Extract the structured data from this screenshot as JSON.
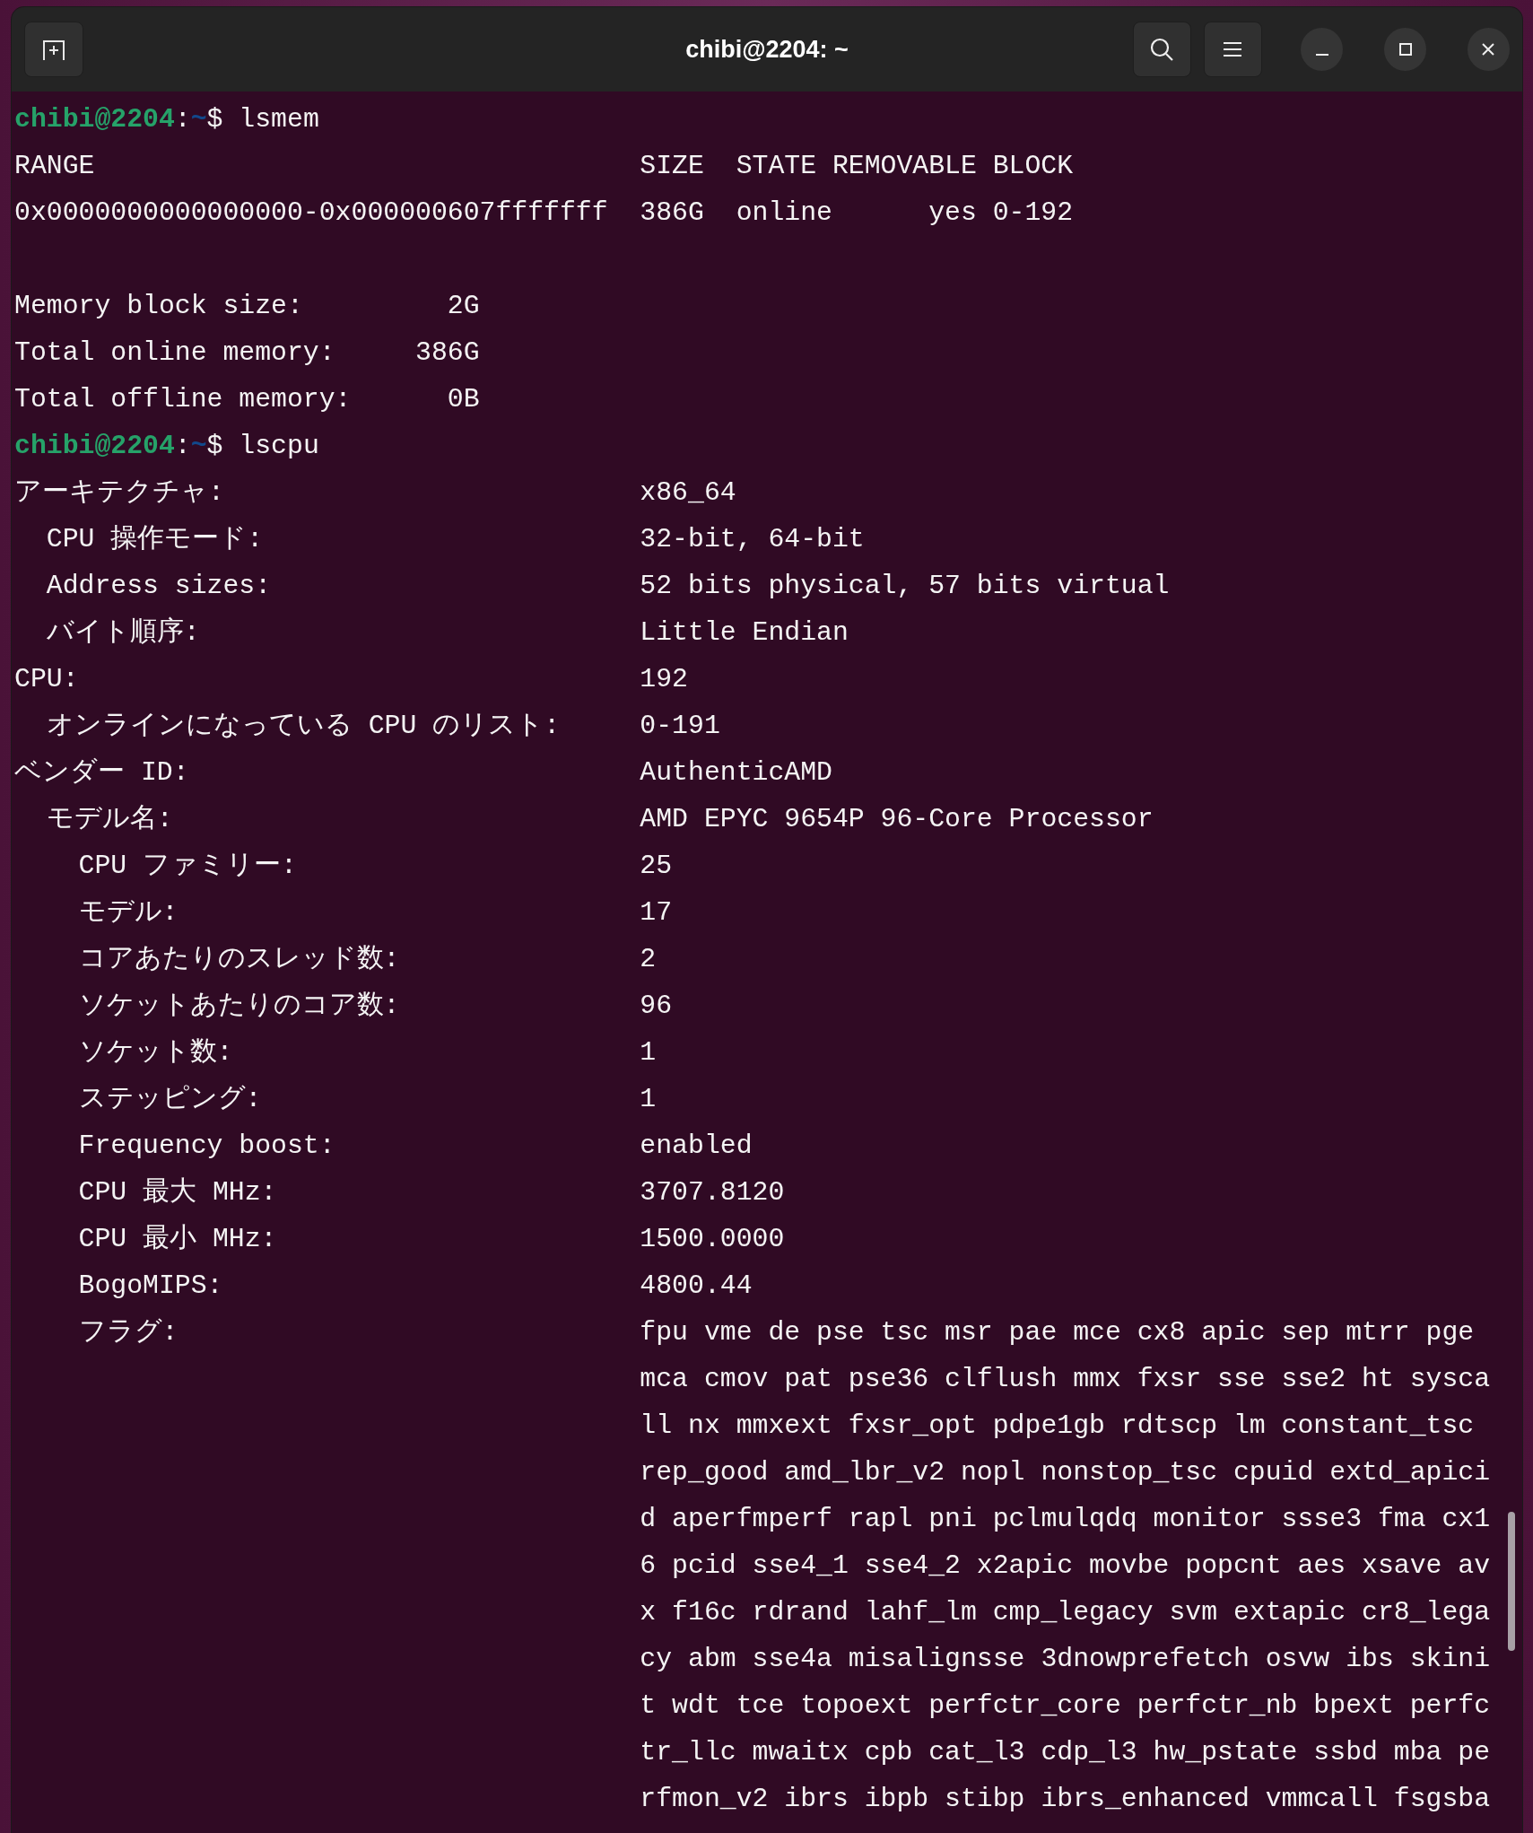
{
  "window": {
    "title": "chibi@2204: ~"
  },
  "blocks": [
    {
      "kind": "prompt",
      "user_host": "chibi@2204",
      "separator": ":",
      "path": "~",
      "symbol": "$",
      "command": "lsmem"
    },
    {
      "kind": "table",
      "columns": [
        "RANGE",
        "SIZE",
        "STATE",
        "REMOVABLE",
        "BLOCK"
      ],
      "rows": [
        [
          "0x0000000000000000-0x000000607fffffff",
          "386G",
          "online",
          "yes",
          "0-192"
        ]
      ]
    },
    {
      "kind": "blank"
    },
    {
      "kind": "summary",
      "items": [
        {
          "label": "Memory block size:",
          "value": "2G"
        },
        {
          "label": "Total online memory:",
          "value": "386G"
        },
        {
          "label": "Total offline memory:",
          "value": "0B"
        }
      ]
    },
    {
      "kind": "prompt",
      "user_host": "chibi@2204",
      "separator": ":",
      "path": "~",
      "symbol": "$",
      "command": "lscpu"
    },
    {
      "kind": "fields",
      "items": [
        {
          "label": "アーキテクチャ:",
          "value": [
            "x86_64"
          ],
          "children": [
            {
              "label": "CPU 操作モード:",
              "value": [
                "32-bit, 64-bit"
              ]
            },
            {
              "label": "Address sizes:",
              "value": [
                "52 bits physical, 57 bits virtual"
              ]
            },
            {
              "label": "バイト順序:",
              "value": [
                "Little Endian"
              ]
            }
          ]
        },
        {
          "label": "CPU:",
          "value": [
            "192"
          ],
          "children": [
            {
              "label": "オンラインになっている CPU のリスト:",
              "value": [
                "0-191"
              ]
            }
          ]
        },
        {
          "label": "ベンダー ID:",
          "value": [
            "AuthenticAMD"
          ],
          "children": [
            {
              "label": "モデル名:",
              "value": [
                "AMD EPYC 9654P 96-Core Processor"
              ],
              "children": [
                {
                  "label": "CPU ファミリー:",
                  "value": [
                    "25"
                  ]
                },
                {
                  "label": "モデル:",
                  "value": [
                    "17"
                  ]
                },
                {
                  "label": "コアあたりのスレッド数:",
                  "value": [
                    "2"
                  ]
                },
                {
                  "label": "ソケットあたりのコア数:",
                  "value": [
                    "96"
                  ]
                },
                {
                  "label": "ソケット数:",
                  "value": [
                    "1"
                  ]
                },
                {
                  "label": "ステッピング:",
                  "value": [
                    "1"
                  ]
                },
                {
                  "label": "Frequency boost:",
                  "value": [
                    "enabled"
                  ]
                },
                {
                  "label": "CPU 最大 MHz:",
                  "value": [
                    "3707.8120"
                  ]
                },
                {
                  "label": "CPU 最小 MHz:",
                  "value": [
                    "1500.0000"
                  ]
                },
                {
                  "label": "BogoMIPS:",
                  "value": [
                    "4800.44"
                  ]
                },
                {
                  "label": "フラグ:",
                  "value": [
                    "fpu vme de pse tsc msr pae mce cx8 apic sep mtrr pge",
                    "mca cmov pat pse36 clflush mmx fxsr sse sse2 ht sysca",
                    "ll nx mmxext fxsr_opt pdpe1gb rdtscp lm constant_tsc",
                    "rep_good amd_lbr_v2 nopl nonstop_tsc cpuid extd_apici",
                    "d aperfmperf rapl pni pclmulqdq monitor ssse3 fma cx1",
                    "6 pcid sse4_1 sse4_2 x2apic movbe popcnt aes xsave av",
                    "x f16c rdrand lahf_lm cmp_legacy svm extapic cr8_lega",
                    "cy abm sse4a misalignsse 3dnowprefetch osvw ibs skini",
                    "t wdt tce topoext perfctr_core perfctr_nb bpext perfc",
                    "tr_llc mwaitx cpb cat_l3 cdp_l3 hw_pstate ssbd mba pe",
                    "rfmon_v2 ibrs ibpb stibp ibrs_enhanced vmmcall fsgsba"
                  ]
                }
              ]
            }
          ]
        }
      ]
    }
  ]
}
